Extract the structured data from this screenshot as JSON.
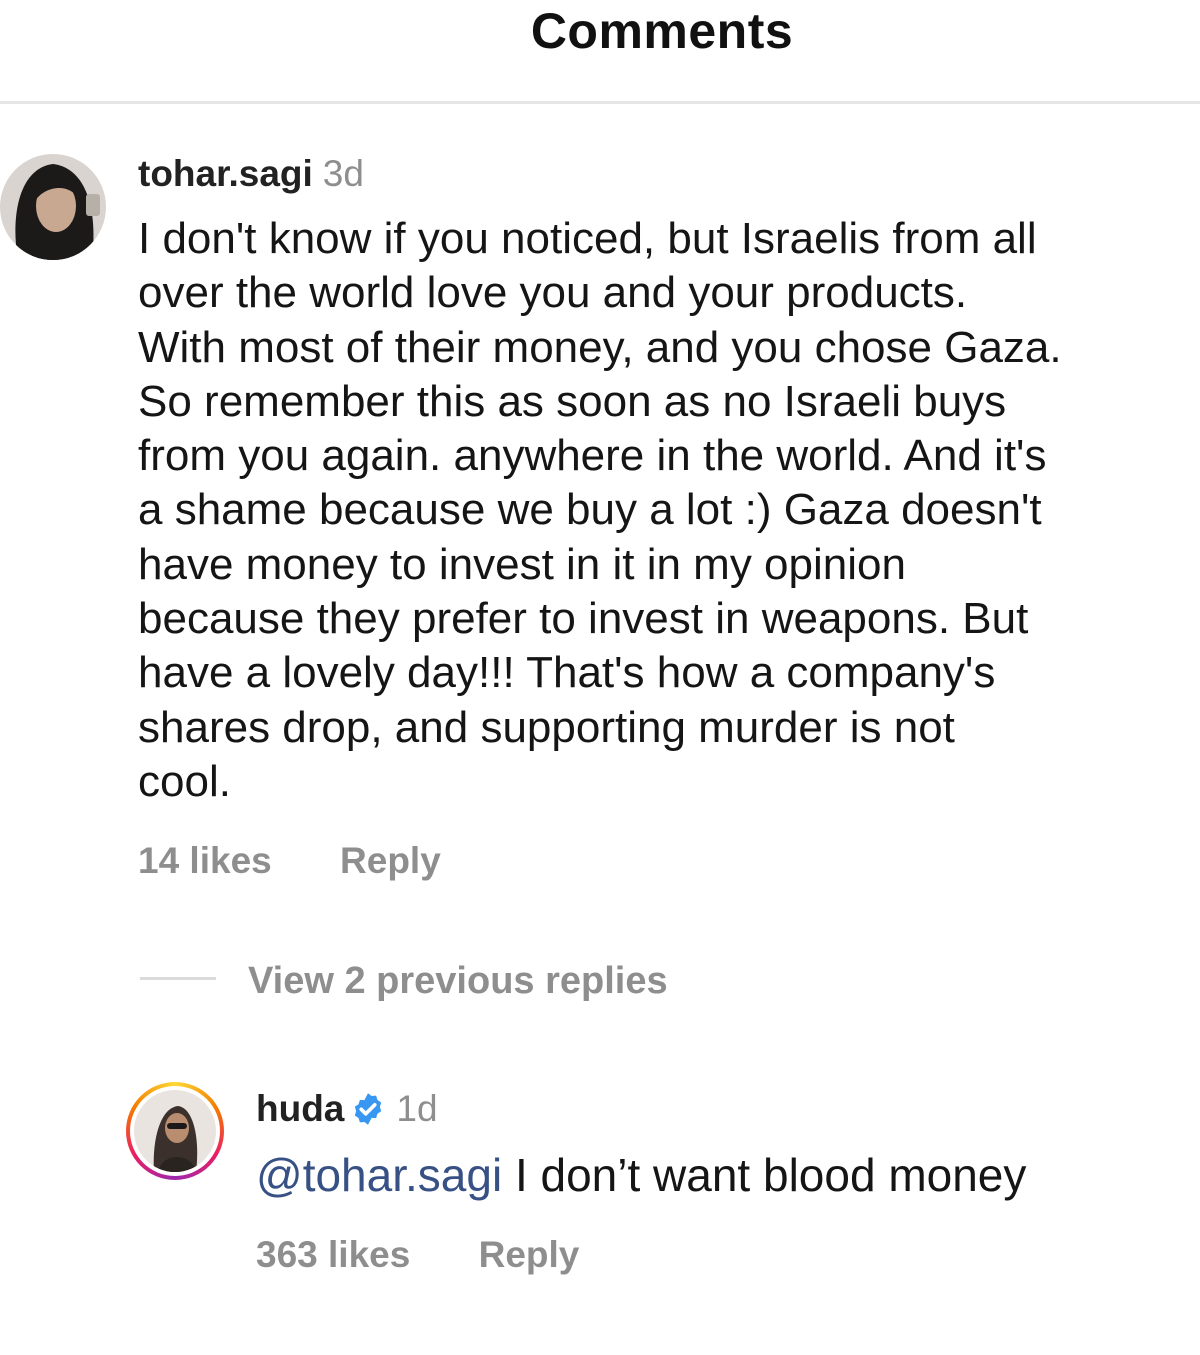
{
  "header": {
    "title": "Comments"
  },
  "comment": {
    "username": "tohar.sagi",
    "time": "3d",
    "lines": [
      "I don't know if you noticed, but Israelis from all",
      "over the world love you and your products.",
      "With most of their money, and you chose Gaza.",
      "So remember this as soon as no Israeli buys",
      "from you again. anywhere in the world. And it's",
      "a shame because we buy a lot :) Gaza doesn't",
      "have money to invest in it in my opinion",
      "because they prefer to invest in weapons. But",
      "have a lovely day!!! That's how a company's",
      "shares drop, and supporting murder is not",
      "cool."
    ],
    "likes": "14 likes",
    "reply_label": "Reply",
    "view_replies": "View 2 previous replies"
  },
  "reply": {
    "username": "huda",
    "verified_icon": "verified-badge-icon",
    "time": "1d",
    "mention": "@tohar.sagi",
    "text": " I don’t want blood money",
    "likes": "363 likes",
    "reply_label": "Reply"
  },
  "colors": {
    "secondary_text": "#8e8e8e",
    "mention": "#385185",
    "verified": "#3897f0",
    "divider": "#e6e6e6"
  }
}
